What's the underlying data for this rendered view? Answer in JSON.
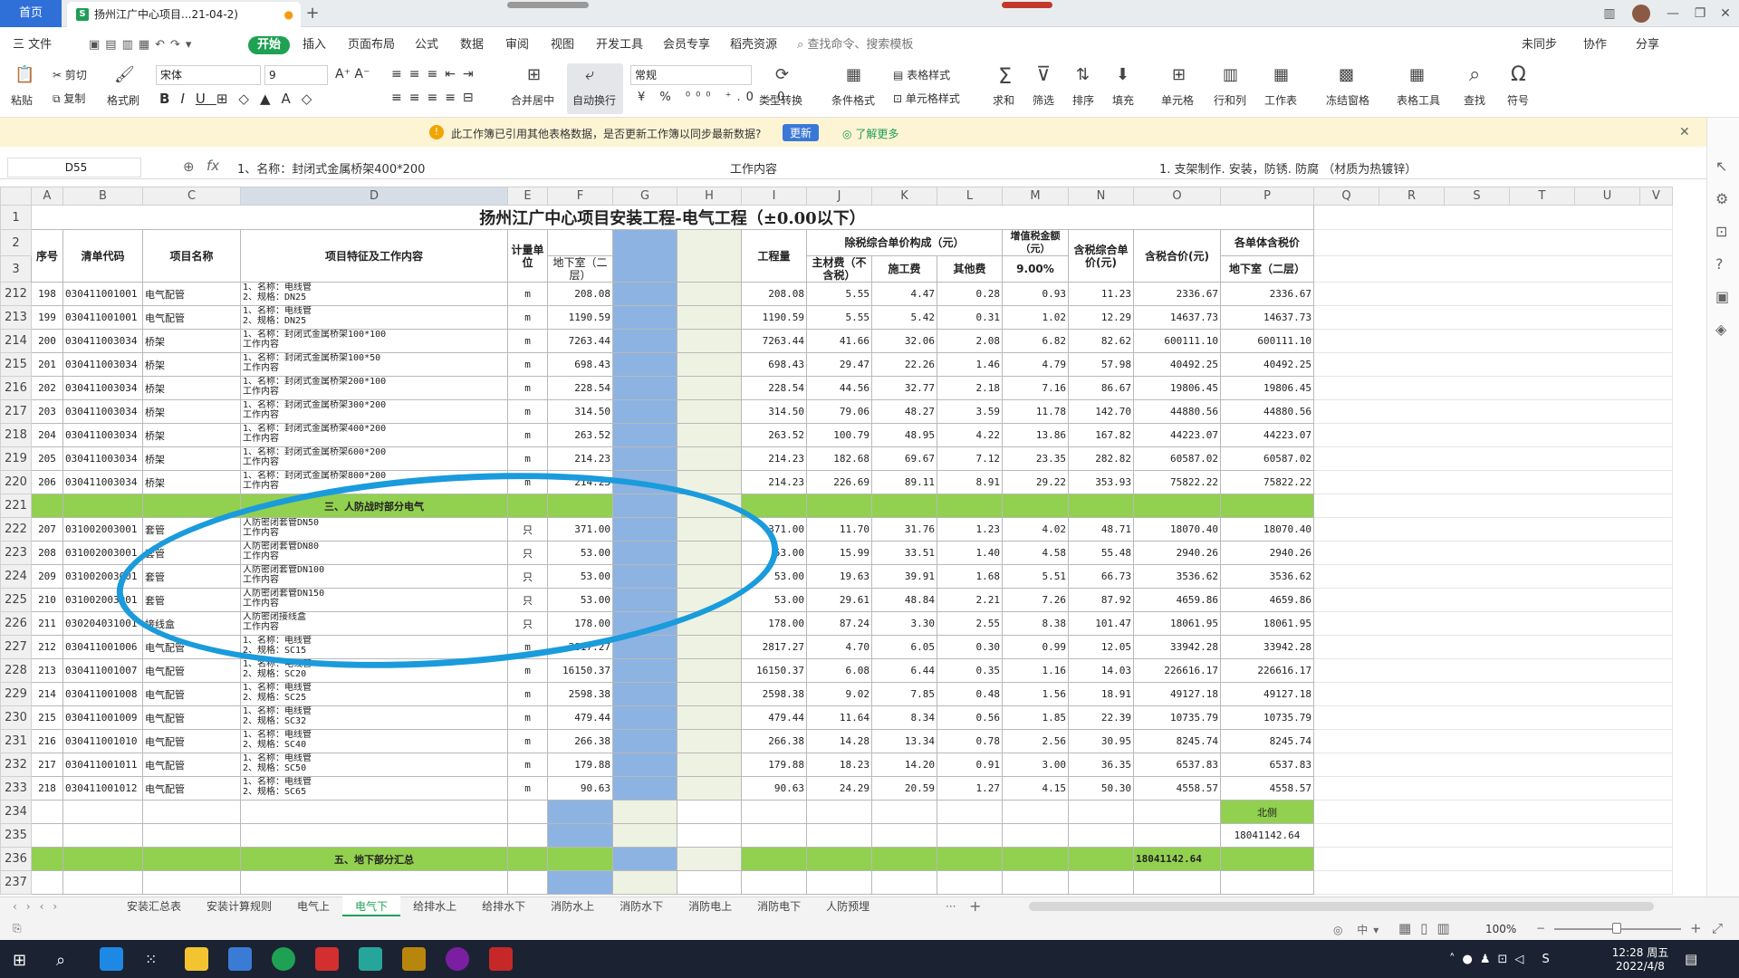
{
  "titlebar": {
    "home_tab": "首页",
    "doc_tab": "扬州江广中心项目...21-04-2)",
    "new_tab": "+"
  },
  "menu": {
    "file": "三 文件",
    "items": [
      "开始",
      "插入",
      "页面布局",
      "公式",
      "数据",
      "审阅",
      "视图",
      "开发工具",
      "会员专享",
      "稻壳资源"
    ],
    "search_placeholder": "查找命令、搜索模板",
    "right": [
      "未同步",
      "协作",
      "分享"
    ]
  },
  "toolbar": {
    "paste": "粘贴",
    "cut": "剪切",
    "copy": "复制",
    "format_painter": "格式刷",
    "font_name": "宋体",
    "font_size": "9",
    "merge": "合并居中",
    "wrap": "自动换行",
    "number_format": "常规",
    "type_convert": "类型转换",
    "cond_format": "条件格式",
    "table_style": "表格样式",
    "cell_style": "单元格样式",
    "sum": "求和",
    "filter": "筛选",
    "sort": "排序",
    "fill": "填充",
    "cell": "单元格",
    "row_col": "行和列",
    "worksheet": "工作表",
    "freeze": "冻结窗格",
    "table_tools": "表格工具",
    "find": "查找",
    "symbol": "符号"
  },
  "notice": {
    "text": "此工作簿已引用其他表格数据，是否更新工作簿以同步最新数据?",
    "update_button": "更新",
    "learn_more": "了解更多"
  },
  "formula_bar": {
    "cell_ref": "D55",
    "content": "1、名称：封闭式金属桥架400*200",
    "part2": "工作内容",
    "part3": "1. 支架制作. 安装，防锈. 防腐 （材质为热镀锌）"
  },
  "columns": [
    "A",
    "B",
    "C",
    "D",
    "E",
    "F",
    "G",
    "H",
    "I",
    "J",
    "K",
    "L",
    "M",
    "N",
    "O",
    "P",
    "Q",
    "R",
    "S",
    "T",
    "U",
    "V"
  ],
  "sheet_title": "扬州江广中心项目安装工程-电气工程（±0.00以下）",
  "headers": {
    "seq": "序号",
    "code": "清单代码",
    "name": "项目名称",
    "feature": "项目特征及工作内容",
    "unit": "计量单位",
    "basement": "地下室（二层）",
    "qty": "工程量",
    "excl_tax": "除税综合单价构成（元）",
    "main_mat": "主材费（不含税）",
    "labor": "施工费",
    "other": "其他费",
    "vat": "增值税金额（元）",
    "vat_rate": "9.00%",
    "unit_price": "含税综合单价(元)",
    "total": "含税合价(元)",
    "each_unit": "各单体含税价",
    "basement2": "地下室（二层）"
  },
  "rows": [
    {
      "rn": "212",
      "seq": "198",
      "code": "030411001001",
      "name": "电气配管",
      "f1": "1、名称：电线管",
      "f2": "2、规格：DN25",
      "unit": "m",
      "qty": "208.08",
      "q2": "208.08",
      "mat": "5.55",
      "lab": "4.47",
      "oth": "0.28",
      "vat": "0.93",
      "up": "11.23",
      "tot": "2336.67",
      "p": "2336.67"
    },
    {
      "rn": "213",
      "seq": "199",
      "code": "030411001001",
      "name": "电气配管",
      "f1": "1、名称：电线管",
      "f2": "2、规格：DN25",
      "unit": "m",
      "qty": "1190.59",
      "q2": "1190.59",
      "mat": "5.55",
      "lab": "5.42",
      "oth": "0.31",
      "vat": "1.02",
      "up": "12.29",
      "tot": "14637.73",
      "p": "14637.73"
    },
    {
      "rn": "214",
      "seq": "200",
      "code": "030411003034",
      "name": "桥架",
      "f1": "1、名称：封闭式金属桥架100*100",
      "f2": "工作内容",
      "unit": "m",
      "qty": "7263.44",
      "q2": "7263.44",
      "mat": "41.66",
      "lab": "32.06",
      "oth": "2.08",
      "vat": "6.82",
      "up": "82.62",
      "tot": "600111.10",
      "p": "600111.10"
    },
    {
      "rn": "215",
      "seq": "201",
      "code": "030411003034",
      "name": "桥架",
      "f1": "1、名称：封闭式金属桥架100*50",
      "f2": "工作内容",
      "unit": "m",
      "qty": "698.43",
      "q2": "698.43",
      "mat": "29.47",
      "lab": "22.26",
      "oth": "1.46",
      "vat": "4.79",
      "up": "57.98",
      "tot": "40492.25",
      "p": "40492.25"
    },
    {
      "rn": "216",
      "seq": "202",
      "code": "030411003034",
      "name": "桥架",
      "f1": "1、名称：封闭式金属桥架200*100",
      "f2": "工作内容",
      "unit": "m",
      "qty": "228.54",
      "q2": "228.54",
      "mat": "44.56",
      "lab": "32.77",
      "oth": "2.18",
      "vat": "7.16",
      "up": "86.67",
      "tot": "19806.45",
      "p": "19806.45"
    },
    {
      "rn": "217",
      "seq": "203",
      "code": "030411003034",
      "name": "桥架",
      "f1": "1、名称：封闭式金属桥架300*200",
      "f2": "工作内容",
      "unit": "m",
      "qty": "314.50",
      "q2": "314.50",
      "mat": "79.06",
      "lab": "48.27",
      "oth": "3.59",
      "vat": "11.78",
      "up": "142.70",
      "tot": "44880.56",
      "p": "44880.56"
    },
    {
      "rn": "218",
      "seq": "204",
      "code": "030411003034",
      "name": "桥架",
      "f1": "1、名称：封闭式金属桥架400*200",
      "f2": "工作内容",
      "unit": "m",
      "qty": "263.52",
      "q2": "263.52",
      "mat": "100.79",
      "lab": "48.95",
      "oth": "4.22",
      "vat": "13.86",
      "up": "167.82",
      "tot": "44223.07",
      "p": "44223.07"
    },
    {
      "rn": "219",
      "seq": "205",
      "code": "030411003034",
      "name": "桥架",
      "f1": "1、名称：封闭式金属桥架600*200",
      "f2": "工作内容",
      "unit": "m",
      "qty": "214.23",
      "q2": "214.23",
      "mat": "182.68",
      "lab": "69.67",
      "oth": "7.12",
      "vat": "23.35",
      "up": "282.82",
      "tot": "60587.02",
      "p": "60587.02"
    },
    {
      "rn": "220",
      "seq": "206",
      "code": "030411003034",
      "name": "桥架",
      "f1": "1、名称：封闭式金属桥架800*200",
      "f2": "工作内容",
      "unit": "m",
      "qty": "214.23",
      "q2": "214.23",
      "mat": "226.69",
      "lab": "89.11",
      "oth": "8.91",
      "vat": "29.22",
      "up": "353.93",
      "tot": "75822.22",
      "p": "75822.22"
    },
    {
      "rn": "221",
      "section": "三、人防战时部分电气"
    },
    {
      "rn": "222",
      "seq": "207",
      "code": "031002003001",
      "name": "套管",
      "f1": "人防密闭套管DN50",
      "f2": "工作内容",
      "unit": "只",
      "qty": "371.00",
      "q2": "371.00",
      "mat": "11.70",
      "lab": "31.76",
      "oth": "1.23",
      "vat": "4.02",
      "up": "48.71",
      "tot": "18070.40",
      "p": "18070.40"
    },
    {
      "rn": "223",
      "seq": "208",
      "code": "031002003001",
      "name": "套管",
      "f1": "人防密闭套管DN80",
      "f2": "工作内容",
      "unit": "只",
      "qty": "53.00",
      "q2": "53.00",
      "mat": "15.99",
      "lab": "33.51",
      "oth": "1.40",
      "vat": "4.58",
      "up": "55.48",
      "tot": "2940.26",
      "p": "2940.26"
    },
    {
      "rn": "224",
      "seq": "209",
      "code": "031002003001",
      "name": "套管",
      "f1": "人防密闭套管DN100",
      "f2": "工作内容",
      "unit": "只",
      "qty": "53.00",
      "q2": "53.00",
      "mat": "19.63",
      "lab": "39.91",
      "oth": "1.68",
      "vat": "5.51",
      "up": "66.73",
      "tot": "3536.62",
      "p": "3536.62"
    },
    {
      "rn": "225",
      "seq": "210",
      "code": "031002003001",
      "name": "套管",
      "f1": "人防密闭套管DN150",
      "f2": "工作内容",
      "unit": "只",
      "qty": "53.00",
      "q2": "53.00",
      "mat": "29.61",
      "lab": "48.84",
      "oth": "2.21",
      "vat": "7.26",
      "up": "87.92",
      "tot": "4659.86",
      "p": "4659.86"
    },
    {
      "rn": "226",
      "seq": "211",
      "code": "030204031001",
      "name": "接线盒",
      "f1": "人防密闭接线盒",
      "f2": "工作内容",
      "unit": "只",
      "qty": "178.00",
      "q2": "178.00",
      "mat": "87.24",
      "lab": "3.30",
      "oth": "2.55",
      "vat": "8.38",
      "up": "101.47",
      "tot": "18061.95",
      "p": "18061.95"
    },
    {
      "rn": "227",
      "seq": "212",
      "code": "030411001006",
      "name": "电气配管",
      "f1": "1、名称：电线管",
      "f2": "2、规格：SC15",
      "unit": "m",
      "qty": "2817.27",
      "q2": "2817.27",
      "mat": "4.70",
      "lab": "6.05",
      "oth": "0.30",
      "vat": "0.99",
      "up": "12.05",
      "tot": "33942.28",
      "p": "33942.28"
    },
    {
      "rn": "228",
      "seq": "213",
      "code": "030411001007",
      "name": "电气配管",
      "f1": "1、名称：电线管",
      "f2": "2、规格：SC20",
      "unit": "m",
      "qty": "16150.37",
      "q2": "16150.37",
      "mat": "6.08",
      "lab": "6.44",
      "oth": "0.35",
      "vat": "1.16",
      "up": "14.03",
      "tot": "226616.17",
      "p": "226616.17"
    },
    {
      "rn": "229",
      "seq": "214",
      "code": "030411001008",
      "name": "电气配管",
      "f1": "1、名称：电线管",
      "f2": "2、规格：SC25",
      "unit": "m",
      "qty": "2598.38",
      "q2": "2598.38",
      "mat": "9.02",
      "lab": "7.85",
      "oth": "0.48",
      "vat": "1.56",
      "up": "18.91",
      "tot": "49127.18",
      "p": "49127.18"
    },
    {
      "rn": "230",
      "seq": "215",
      "code": "030411001009",
      "name": "电气配管",
      "f1": "1、名称：电线管",
      "f2": "2、规格：SC32",
      "unit": "m",
      "qty": "479.44",
      "q2": "479.44",
      "mat": "11.64",
      "lab": "8.34",
      "oth": "0.56",
      "vat": "1.85",
      "up": "22.39",
      "tot": "10735.79",
      "p": "10735.79"
    },
    {
      "rn": "231",
      "seq": "216",
      "code": "030411001010",
      "name": "电气配管",
      "f1": "1、名称：电线管",
      "f2": "2、规格：SC40",
      "unit": "m",
      "qty": "266.38",
      "q2": "266.38",
      "mat": "14.28",
      "lab": "13.34",
      "oth": "0.78",
      "vat": "2.56",
      "up": "30.95",
      "tot": "8245.74",
      "p": "8245.74"
    },
    {
      "rn": "232",
      "seq": "217",
      "code": "030411001011",
      "name": "电气配管",
      "f1": "1、名称：电线管",
      "f2": "2、规格：SC50",
      "unit": "m",
      "qty": "179.88",
      "q2": "179.88",
      "mat": "18.23",
      "lab": "14.20",
      "oth": "0.91",
      "vat": "3.00",
      "up": "36.35",
      "tot": "6537.83",
      "p": "6537.83"
    },
    {
      "rn": "233",
      "seq": "218",
      "code": "030411001012",
      "name": "电气配管",
      "f1": "1、名称：电线管",
      "f2": "2、规格：SC65",
      "unit": "m",
      "qty": "90.63",
      "q2": "90.63",
      "mat": "24.29",
      "lab": "20.59",
      "oth": "1.27",
      "vat": "4.15",
      "up": "50.30",
      "tot": "4558.57",
      "p": "4558.57"
    }
  ],
  "footer_rows": {
    "r234": {
      "rn": "234",
      "p": "北侧"
    },
    "r235": {
      "rn": "235",
      "p": "18041142.64"
    },
    "r236": {
      "rn": "236",
      "section": "五、地下部分汇总",
      "tot": "18041142.64"
    },
    "r237": {
      "rn": "237"
    }
  },
  "sheet_tabs": [
    "安装汇总表",
    "安装计算规则",
    "电气上",
    "电气下",
    "给排水上",
    "给排水下",
    "消防水上",
    "消防水下",
    "消防电上",
    "消防电下",
    "人防预埋"
  ],
  "active_sheet": "电气下",
  "status": {
    "zoom": "100%"
  },
  "taskbar": {
    "time": "12:28 周五",
    "date": "2022/4/8"
  },
  "colors": {
    "accent": "#2f6fd8",
    "green_start": "#1fa153",
    "section_green": "#92d050",
    "blue_col": "#8db3e2",
    "circle": "#1a9bdc"
  }
}
